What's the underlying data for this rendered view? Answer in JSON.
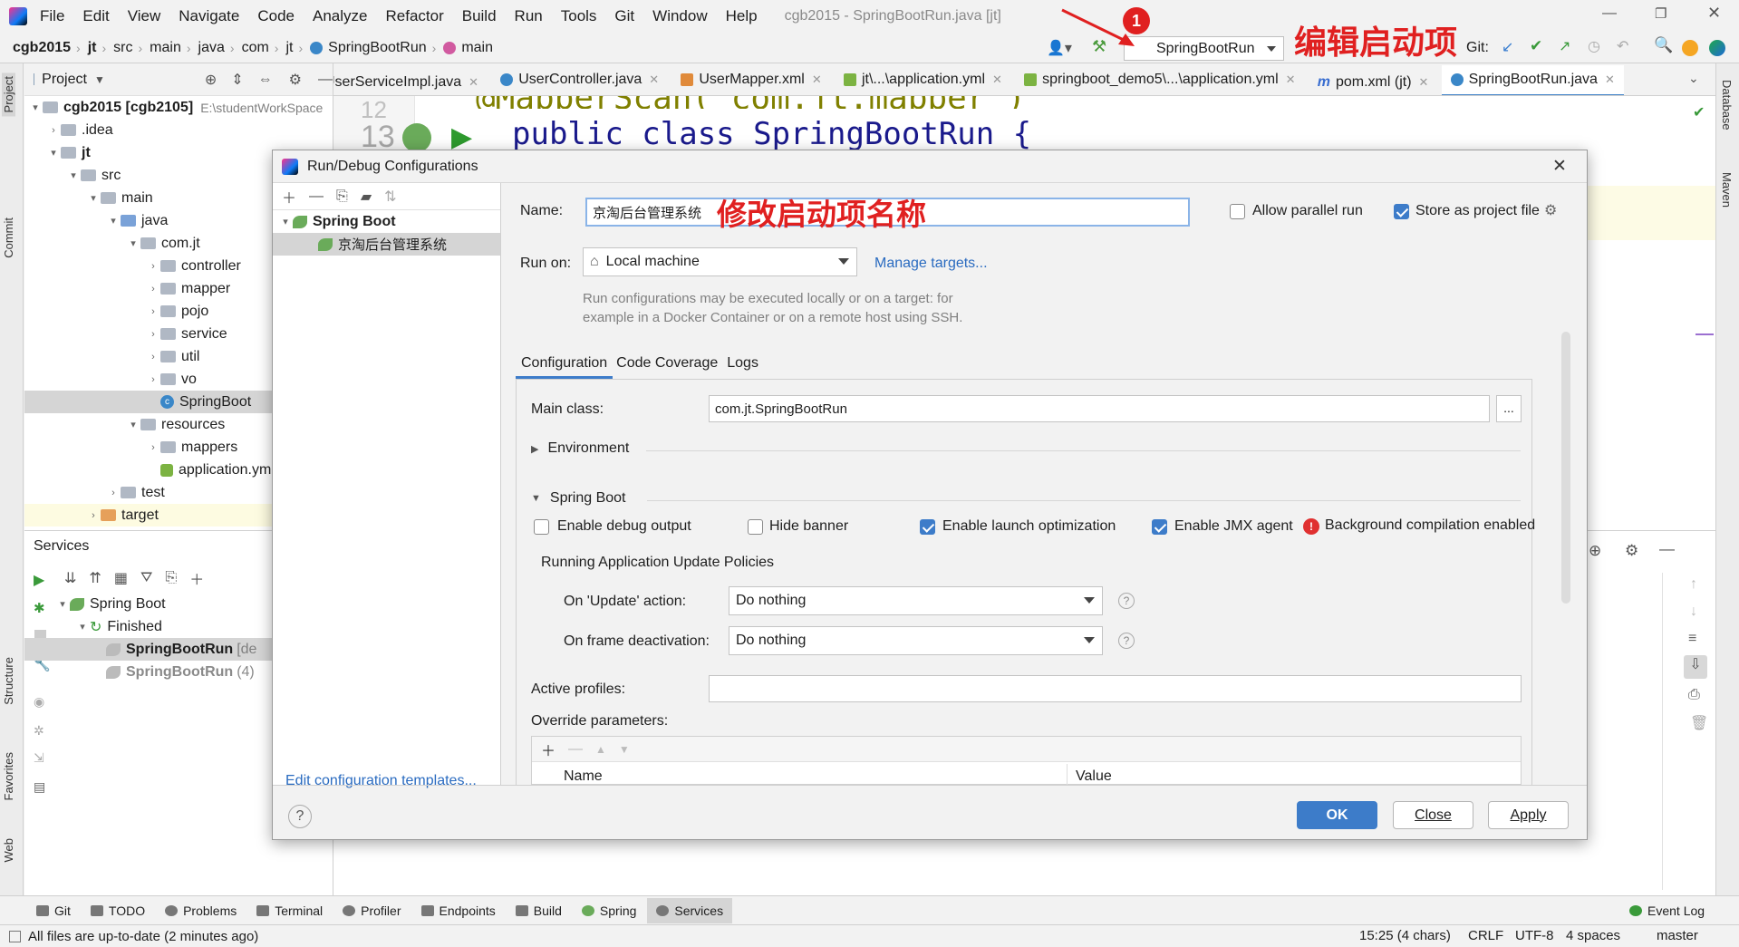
{
  "window": {
    "title": "cgb2015 - SpringBootRun.java [jt]"
  },
  "menu": [
    "File",
    "Edit",
    "View",
    "Navigate",
    "Code",
    "Analyze",
    "Refactor",
    "Build",
    "Run",
    "Tools",
    "Git",
    "Window",
    "Help"
  ],
  "breadcrumb": [
    "cgb2015",
    "jt",
    "src",
    "main",
    "java",
    "com",
    "jt",
    "SpringBootRun",
    "main"
  ],
  "run_config_selector": "SpringBootRun",
  "git_label": "Git:",
  "annotations": {
    "marker": "1",
    "edit_config": "编辑启动项",
    "rename_config": "修改启动项名称"
  },
  "project_panel": {
    "title": "Project",
    "tree": [
      {
        "label": "cgb2015 [cgb2105]",
        "extra": "E:\\studentWorkSpace"
      },
      {
        "label": ".idea"
      },
      {
        "label": "jt"
      },
      {
        "label": "src"
      },
      {
        "label": "main"
      },
      {
        "label": "java"
      },
      {
        "label": "com.jt"
      },
      {
        "label": "controller"
      },
      {
        "label": "mapper"
      },
      {
        "label": "pojo"
      },
      {
        "label": "service"
      },
      {
        "label": "util"
      },
      {
        "label": "vo"
      },
      {
        "label": "SpringBoot"
      },
      {
        "label": "resources"
      },
      {
        "label": "mappers"
      },
      {
        "label": "application.ym"
      },
      {
        "label": "test"
      },
      {
        "label": "target"
      }
    ]
  },
  "services_panel": {
    "title": "Services",
    "tree": [
      {
        "label": "Spring Boot"
      },
      {
        "label": "Finished"
      },
      {
        "label": "SpringBootRun",
        "suffix": "[de"
      },
      {
        "label": "SpringBootRun",
        "suffix": "(4)"
      }
    ]
  },
  "editor_tabs": [
    "UserServiceImpl.java",
    "UserController.java",
    "UserMapper.xml",
    "jt\\...\\application.yml",
    "springboot_demo5\\...\\application.yml",
    "pom.xml (jt)",
    "SpringBootRun.java"
  ],
  "editor": {
    "line_prev": "12",
    "line": "13",
    "code": "public class SpringBootRun {"
  },
  "dialog": {
    "title": "Run/Debug Configurations",
    "tree_group": "Spring Boot",
    "tree_item": "京淘后台管理系统",
    "edit_templates": "Edit configuration templates...",
    "name_label": "Name:",
    "name_value": "京淘后台管理系统",
    "allow_parallel": "Allow parallel run",
    "allow_parallel_checked": false,
    "store_project": "Store as project file",
    "store_project_checked": true,
    "run_on_label": "Run on:",
    "run_on_value": "Local machine",
    "manage_targets": "Manage targets...",
    "hint_line1": "Run configurations may be executed locally or on a target: for",
    "hint_line2": "example in a Docker Container or on a remote host using SSH.",
    "tabs": [
      "Configuration",
      "Code Coverage",
      "Logs"
    ],
    "main_class_label": "Main class:",
    "main_class_value": "com.jt.SpringBootRun",
    "environment": "Environment",
    "spring_boot_section": "Spring Boot",
    "enable_debug": "Enable debug output",
    "hide_banner": "Hide banner",
    "launch_opt": "Enable launch optimization",
    "jmx_agent": "Enable JMX agent",
    "bg_compile": "Background compilation enabled",
    "checks": {
      "debug": false,
      "banner": false,
      "launch": true,
      "jmx": true
    },
    "update_policies": "Running Application Update Policies",
    "on_update_label": "On 'Update' action:",
    "on_update_value": "Do nothing",
    "on_frame_label": "On frame deactivation:",
    "on_frame_value": "Do nothing",
    "active_profiles_label": "Active profiles:",
    "override_label": "Override parameters:",
    "col_name": "Name",
    "col_value": "Value",
    "ok": "OK",
    "close": "Close",
    "apply": "Apply",
    "help": "?"
  },
  "bottom_tools": [
    "Git",
    "TODO",
    "Problems",
    "Terminal",
    "Profiler",
    "Endpoints",
    "Build",
    "Spring",
    "Services"
  ],
  "event_log": "Event Log",
  "status": {
    "message": "All files are up-to-date (2 minutes ago)",
    "position": "15:25 (4 chars)",
    "line_sep": "CRLF",
    "encoding": "UTF-8",
    "indent": "4 spaces",
    "branch": "master"
  },
  "side_tabs": {
    "left": [
      "Project",
      "Commit",
      "Structure",
      "Favorites",
      "Web"
    ],
    "right": [
      "Database",
      "Maven"
    ]
  },
  "colors": {
    "accent": "#3d7cc9",
    "annotation": "#e02020",
    "selection": "#d5d5d5"
  }
}
